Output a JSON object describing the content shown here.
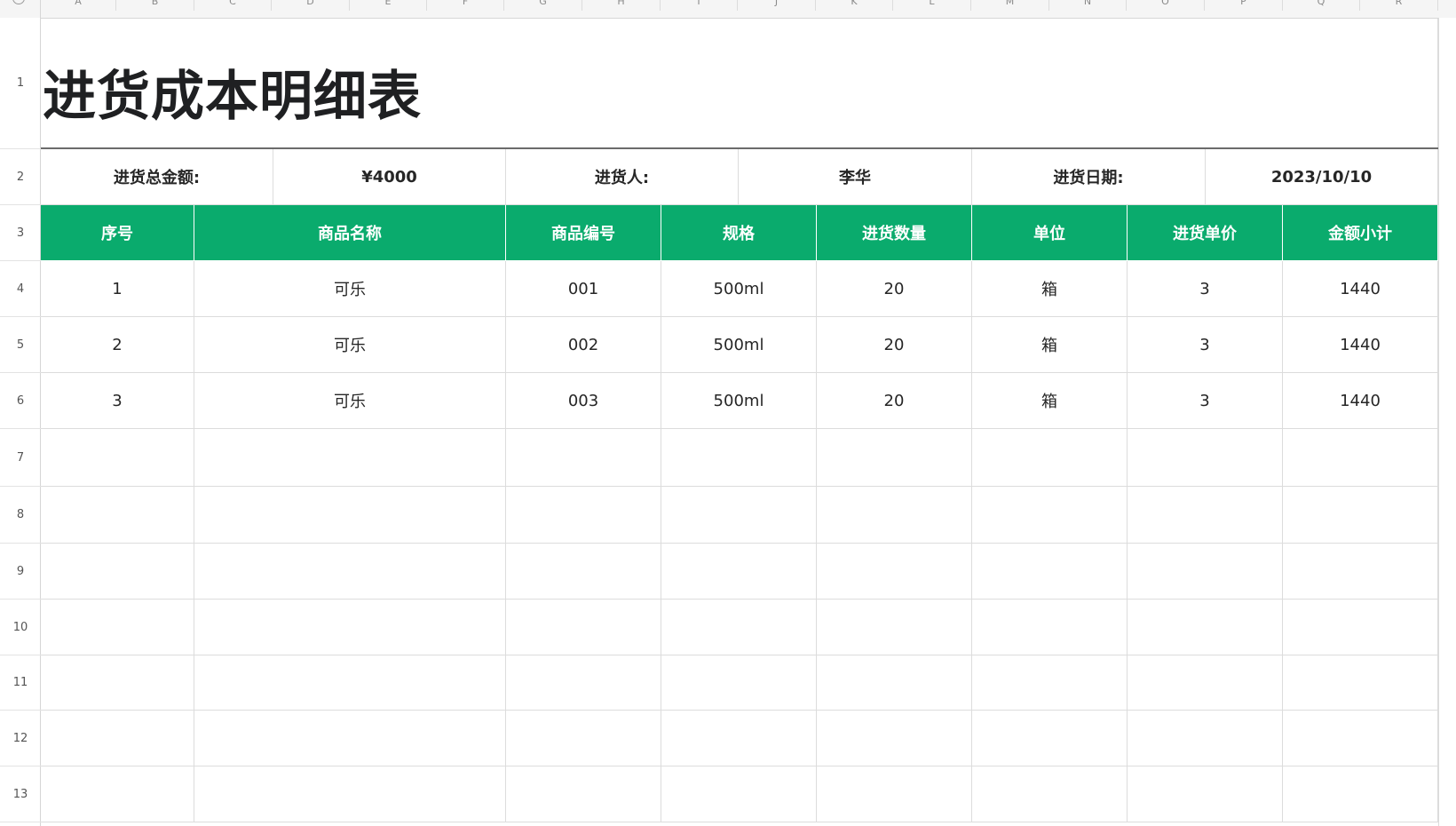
{
  "sheet": {
    "title": "进货成本明细表",
    "column_letters": [
      "A",
      "B",
      "C",
      "D",
      "E",
      "F",
      "G",
      "H",
      "I",
      "J",
      "K",
      "L",
      "M",
      "N",
      "O",
      "P",
      "Q",
      "R"
    ],
    "row_numbers": [
      "1",
      "2",
      "3",
      "4",
      "5",
      "6",
      "7",
      "8",
      "9",
      "10",
      "11",
      "12",
      "13"
    ],
    "info": {
      "total_label": "进货总金额:",
      "total_value": "¥4000",
      "buyer_label": "进货人:",
      "buyer_value": "李华",
      "date_label": "进货日期:",
      "date_value": "2023/10/10"
    },
    "table": {
      "headers": [
        "序号",
        "商品名称",
        "商品编号",
        "规格",
        "进货数量",
        "单位",
        "进货单价",
        "金额小计"
      ],
      "rows": [
        [
          "1",
          "可乐",
          "001",
          "500ml",
          "20",
          "箱",
          "3",
          "1440"
        ],
        [
          "2",
          "可乐",
          "002",
          "500ml",
          "20",
          "箱",
          "3",
          "1440"
        ],
        [
          "3",
          "可乐",
          "003",
          "500ml",
          "20",
          "箱",
          "3",
          "1440"
        ]
      ],
      "empty_rows": 7
    },
    "colors": {
      "header_green": "#0aab6d",
      "header_text": "#ffffff",
      "title_text": "#1f2022",
      "grid_line": "#dcdcdc"
    }
  }
}
